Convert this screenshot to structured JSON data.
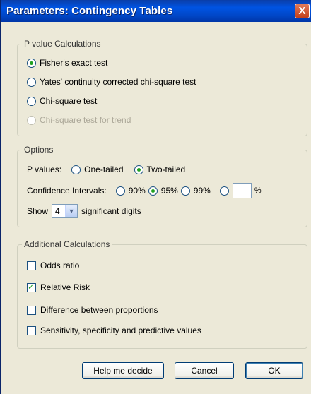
{
  "window": {
    "title": "Parameters: Contingency Tables",
    "close_glyph": "X"
  },
  "pvalue_group": {
    "legend": "P value Calculations",
    "options": [
      {
        "label": "Fisher's exact test",
        "checked": true,
        "enabled": true
      },
      {
        "label": "Yates' continuity corrected chi-square test",
        "checked": false,
        "enabled": true
      },
      {
        "label": "Chi-square test",
        "checked": false,
        "enabled": true
      },
      {
        "label": "Chi-square test for trend",
        "checked": false,
        "enabled": false
      }
    ]
  },
  "options_group": {
    "legend": "Options",
    "pvalues_label": "P values:",
    "one_tailed": "One-tailed",
    "two_tailed": "Two-tailed",
    "ci_label": "Confidence Intervals:",
    "ci_90": "90%",
    "ci_95": "95%",
    "ci_99": "99%",
    "ci_custom_value": "",
    "ci_percent": "%",
    "show_label": "Show",
    "digits_value": "4",
    "digits_suffix": "significant digits"
  },
  "additional_group": {
    "legend": "Additional Calculations",
    "items": [
      {
        "label": "Odds ratio",
        "checked": false
      },
      {
        "label": "Relative Risk",
        "checked": true
      },
      {
        "label": "Difference between proportions",
        "checked": false
      },
      {
        "label": "Sensitivity, specificity and predictive values",
        "checked": false
      }
    ]
  },
  "buttons": {
    "help": "Help me decide",
    "cancel": "Cancel",
    "ok": "OK"
  }
}
